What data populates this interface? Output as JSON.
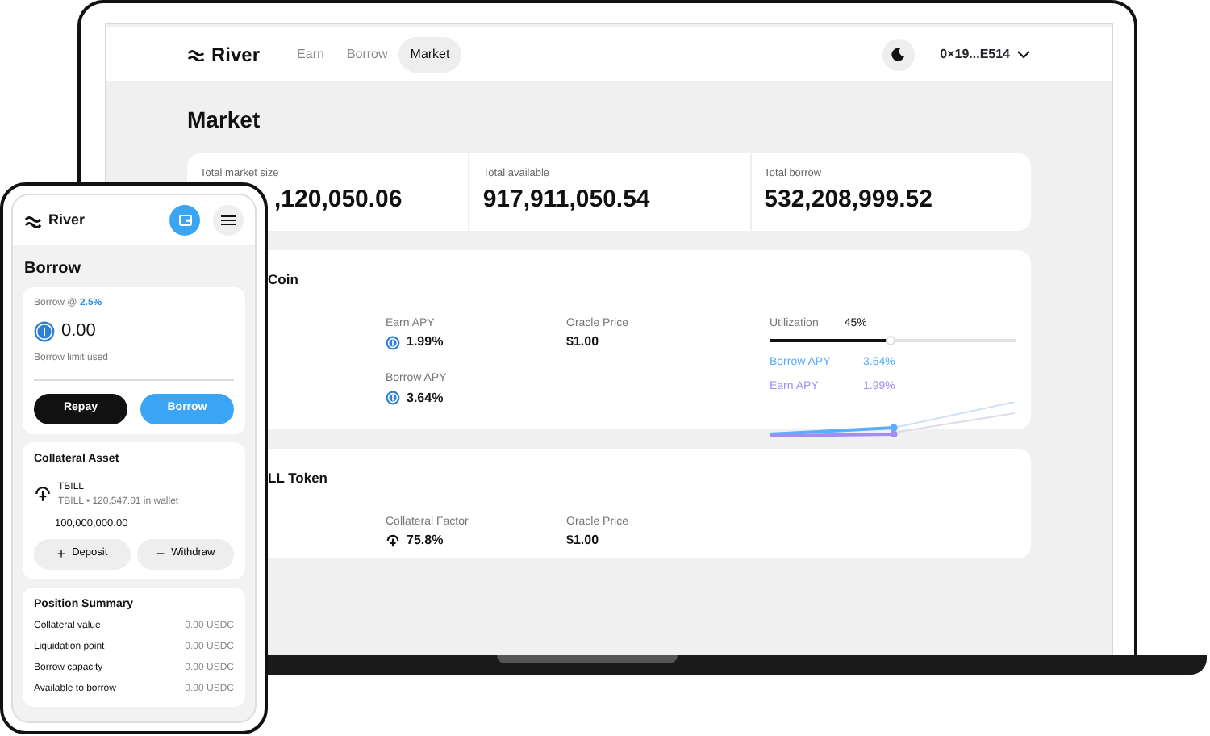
{
  "laptop": {
    "nav": {
      "logo": "River",
      "links": [
        {
          "label": "Earn",
          "selected": false
        },
        {
          "label": "Borrow",
          "selected": false
        },
        {
          "label": "Market",
          "selected": true
        }
      ],
      "wallet": "0×19...E514"
    },
    "title": "Market",
    "stats": [
      {
        "label": "Total market size",
        "value": ",120,050.06"
      },
      {
        "label": "Total available",
        "value": "917,911,050.54"
      },
      {
        "label": "Total borrow",
        "value": "532,208,999.52"
      }
    ],
    "markets": [
      {
        "title": "Coin",
        "metrics": [
          {
            "label": "Earn APY",
            "value": "1.99%",
            "kind": "apy"
          },
          {
            "label": "Oracle Price",
            "value": "$1.00",
            "kind": "price"
          },
          {
            "label": "Borrow APY",
            "value": "3.64%",
            "kind": "apy"
          }
        ],
        "utilization": {
          "label": "Utilization",
          "value": "45%",
          "level": 0.49,
          "legend": [
            {
              "label": "Borrow APY",
              "value": "3.64%",
              "color": "#5aaefb"
            },
            {
              "label": "Earn APY",
              "value": "1.99%",
              "color": "#a48cf5"
            }
          ]
        }
      },
      {
        "title": "LL Token",
        "metrics": [
          {
            "label": "Collateral Factor",
            "value": "75.8%",
            "kind": "factor"
          },
          {
            "label": "Oracle Price",
            "value": "$1.00",
            "kind": "price"
          }
        ]
      }
    ]
  },
  "phone": {
    "logo": "River",
    "title": "Borrow",
    "borrow": {
      "label": "Borrow @",
      "rate": "2.5%",
      "amount": "0.00",
      "limit_label": "Borrow limit used",
      "level": 0,
      "buttons": [
        {
          "label": "Repay",
          "kind": "dark"
        },
        {
          "label": "Borrow",
          "kind": "blue"
        }
      ]
    },
    "collateral": {
      "title": "Collateral Asset",
      "asset": "TBILL",
      "detail": "TBILL • 120,547.01 in wallet",
      "amount": "100,000,000.00",
      "buttons": [
        {
          "icon": "+",
          "label": "Deposit"
        },
        {
          "icon": "−",
          "label": "Withdraw"
        }
      ]
    },
    "summary": {
      "title": "Position Summary",
      "rows": [
        {
          "label": "Collateral value",
          "value": "0.00 USDC"
        },
        {
          "label": "Liquidation point",
          "value": "0.00 USDC"
        },
        {
          "label": "Borrow capacity",
          "value": "0.00 USDC"
        },
        {
          "label": "Available to borrow",
          "value": "0.00 USDC"
        }
      ]
    }
  }
}
